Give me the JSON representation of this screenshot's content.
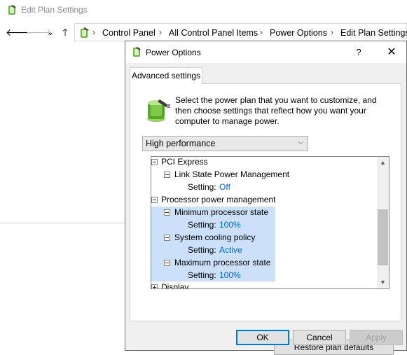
{
  "window": {
    "title": "Edit Plan Settings"
  },
  "nav": {
    "back_icon": "arrow-left-icon",
    "forward_icon": "arrow-right-icon",
    "recent_icon": "chevron-down-icon",
    "up_icon": "arrow-up-icon",
    "back_glyph": "🡐",
    "forward_glyph": "🡒",
    "recent_glyph": "⌄",
    "up_glyph": "🡑",
    "separator": "›",
    "breadcrumbs": [
      "Control Panel",
      "All Control Panel Items",
      "Power Options",
      "Edit Plan Settings"
    ]
  },
  "dialog": {
    "title": "Power Options",
    "help_label": "?",
    "close_label": "✕",
    "tab_label": "Advanced settings",
    "description": "Select the power plan that you want to customize, and then choose settings that reflect how you want your computer to manage power.",
    "plan_selected": "High performance",
    "dropdown_glyph": "⌵",
    "tree": {
      "scroll_up_glyph": "▲",
      "scroll_down_glyph": "▼",
      "rows": [
        {
          "kind": "group",
          "label": "PCI Express",
          "expanded": true
        },
        {
          "kind": "subgroup",
          "label": "Link State Power Management",
          "expanded": true
        },
        {
          "kind": "setting",
          "label": "Setting:",
          "value": "Off"
        },
        {
          "kind": "group",
          "label": "Processor power management",
          "expanded": true
        },
        {
          "kind": "subgroup",
          "label": "Minimum processor state",
          "expanded": true
        },
        {
          "kind": "setting",
          "label": "Setting:",
          "value": "100%"
        },
        {
          "kind": "subgroup",
          "label": "System cooling policy",
          "expanded": true
        },
        {
          "kind": "setting",
          "label": "Setting:",
          "value": "Active"
        },
        {
          "kind": "subgroup",
          "label": "Maximum processor state",
          "expanded": true
        },
        {
          "kind": "setting",
          "label": "Setting:",
          "value": "100%"
        },
        {
          "kind": "group",
          "label": "Display",
          "expanded": false
        }
      ]
    },
    "restore_label": "Restore plan defaults",
    "ok_label": "OK",
    "cancel_label": "Cancel",
    "apply_label": "Apply"
  },
  "colors": {
    "highlight": "#cce0fa",
    "setting_value": "#0066cc",
    "focus_border": "#0078d7"
  }
}
